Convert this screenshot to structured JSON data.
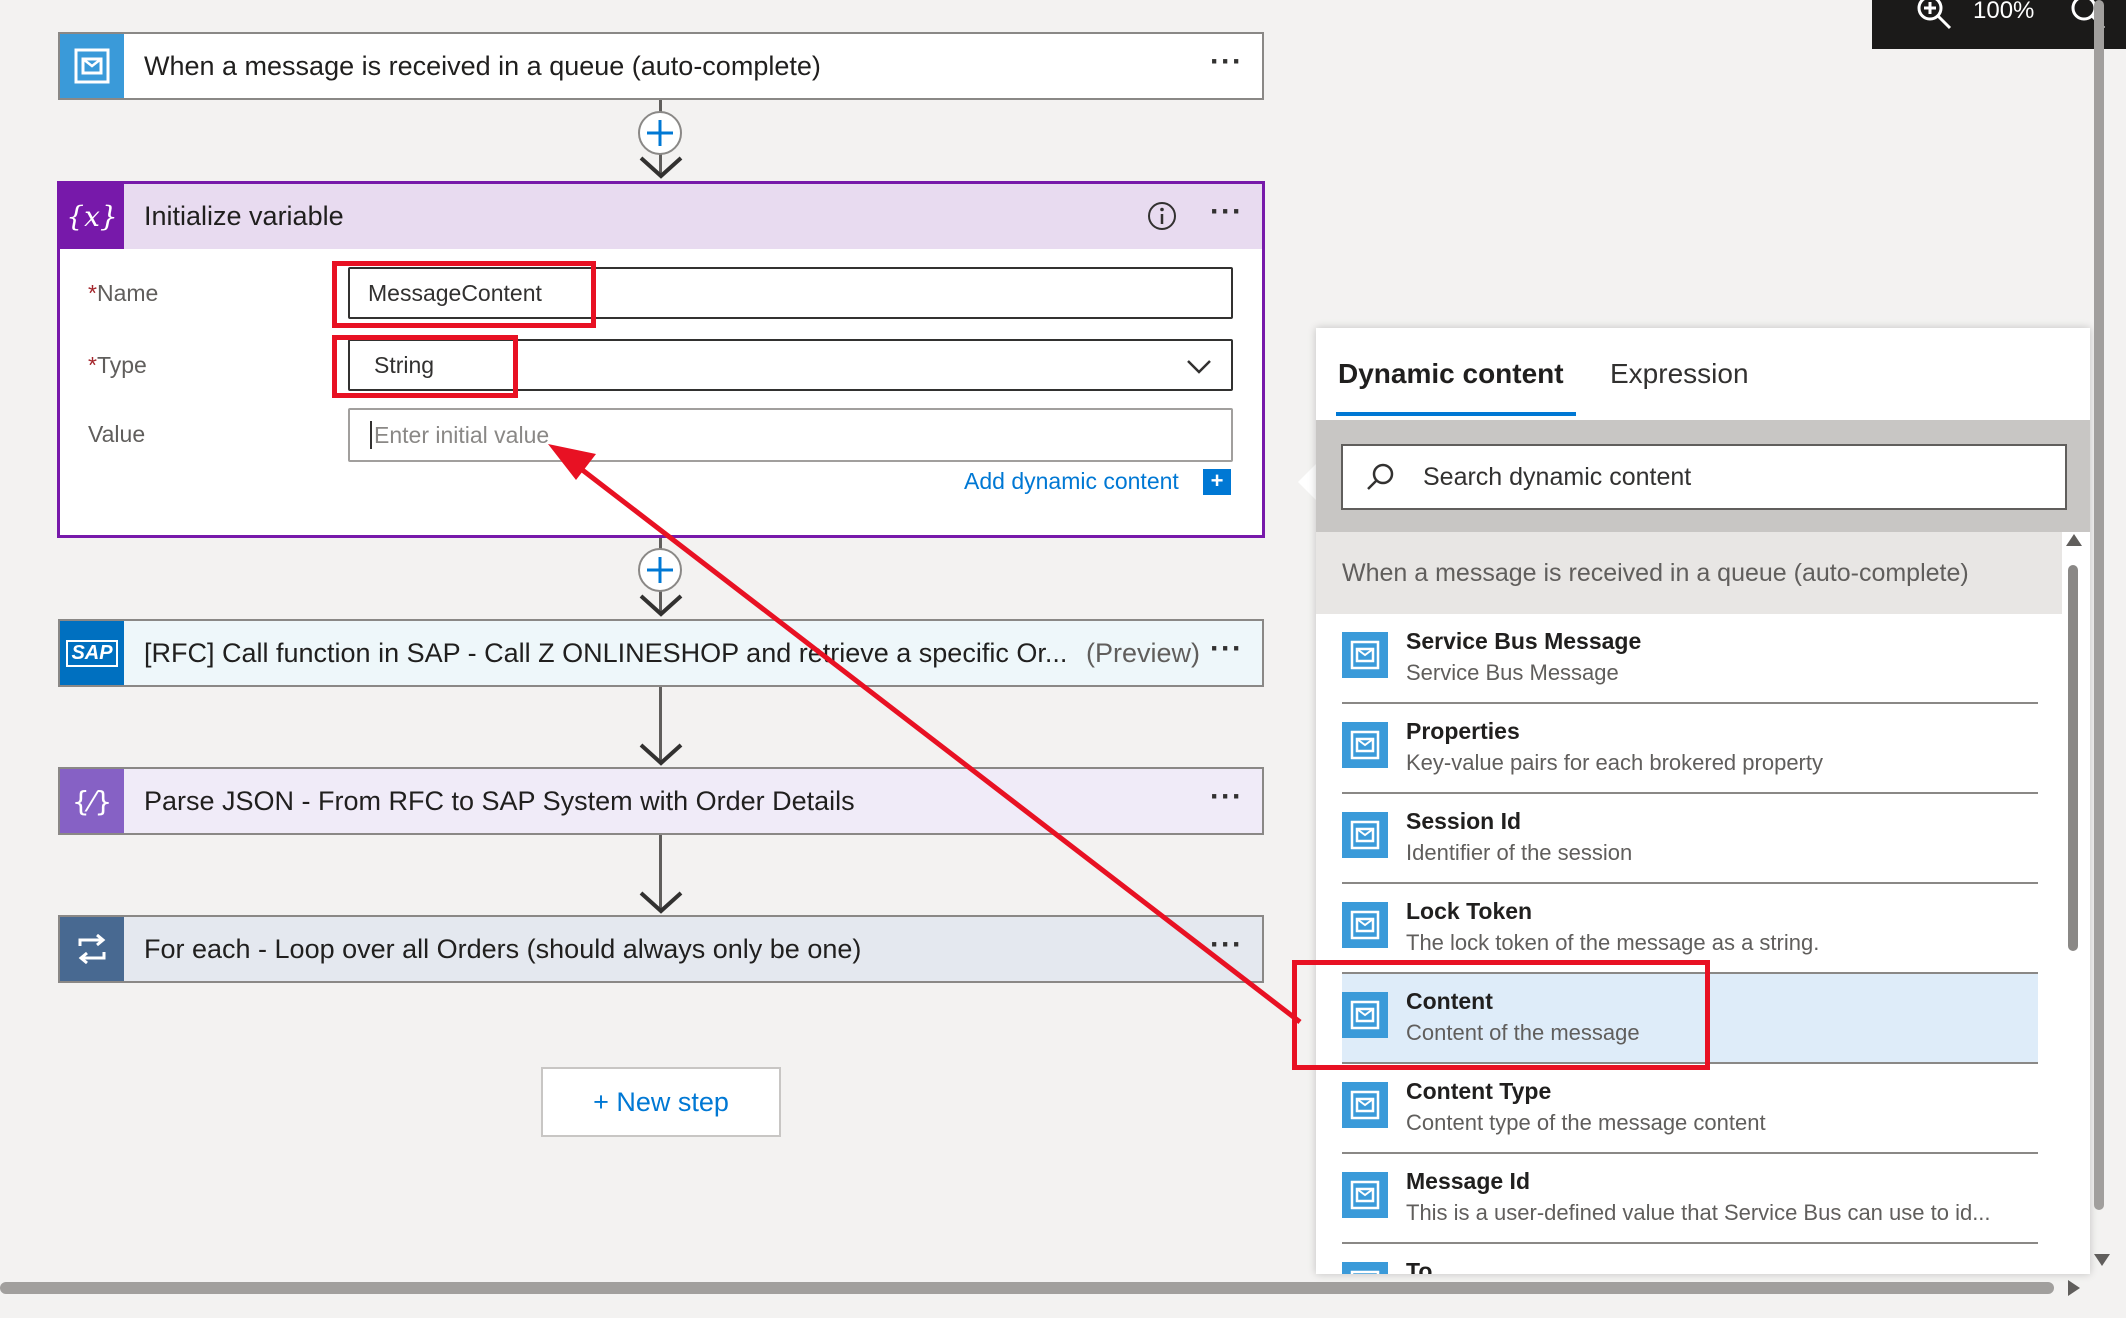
{
  "zoom": {
    "level": "100%",
    "zoom_in_icon": "zoom-in-icon",
    "zoom_out_icon": "zoom-out-icon"
  },
  "steps": {
    "trigger": {
      "title": "When a message is received in a queue (auto-complete)",
      "icon": "service-bus-icon",
      "color": "#3a9ad9"
    },
    "init_variable": {
      "title": "Initialize variable",
      "icon": "variable-icon",
      "color": "#7719aa",
      "name_label": "Name",
      "name_value": "MessageContent",
      "type_label": "Type",
      "type_value": "String",
      "value_label": "Value",
      "value_placeholder": "Enter initial value",
      "add_dynamic": "Add dynamic content",
      "required_mark": "*"
    },
    "sap": {
      "title": "[RFC] Call function in SAP - Call Z ONLINESHOP and retrieve a specific Or...",
      "preview": "(Preview)",
      "icon": "sap-icon",
      "color": "#0070c0"
    },
    "parse_json": {
      "title": "Parse JSON - From RFC to SAP System with Order Details",
      "icon": "parse-json-icon",
      "color": "#8661c5"
    },
    "for_each": {
      "title": "For each - Loop over all Orders (should always only be one)",
      "icon": "loop-icon",
      "color": "#486991"
    },
    "more_label": "···"
  },
  "new_step": {
    "label": "+ New step"
  },
  "dynamic_panel": {
    "tabs": [
      "Dynamic content",
      "Expression"
    ],
    "search_placeholder": "Search dynamic content",
    "section": "When a message is received in a queue (auto-complete)",
    "items": [
      {
        "title": "Service Bus Message",
        "desc": "Service Bus Message"
      },
      {
        "title": "Properties",
        "desc": "Key-value pairs for each brokered property"
      },
      {
        "title": "Session Id",
        "desc": "Identifier of the session"
      },
      {
        "title": "Lock Token",
        "desc": "The lock token of the message as a string."
      },
      {
        "title": "Content",
        "desc": "Content of the message"
      },
      {
        "title": "Content Type",
        "desc": "Content type of the message content"
      },
      {
        "title": "Message Id",
        "desc": "This is a user-defined value that Service Bus can use to id..."
      },
      {
        "title": "To",
        "desc": ""
      }
    ],
    "selected_index": 4
  },
  "annotation_color": "#e81123"
}
